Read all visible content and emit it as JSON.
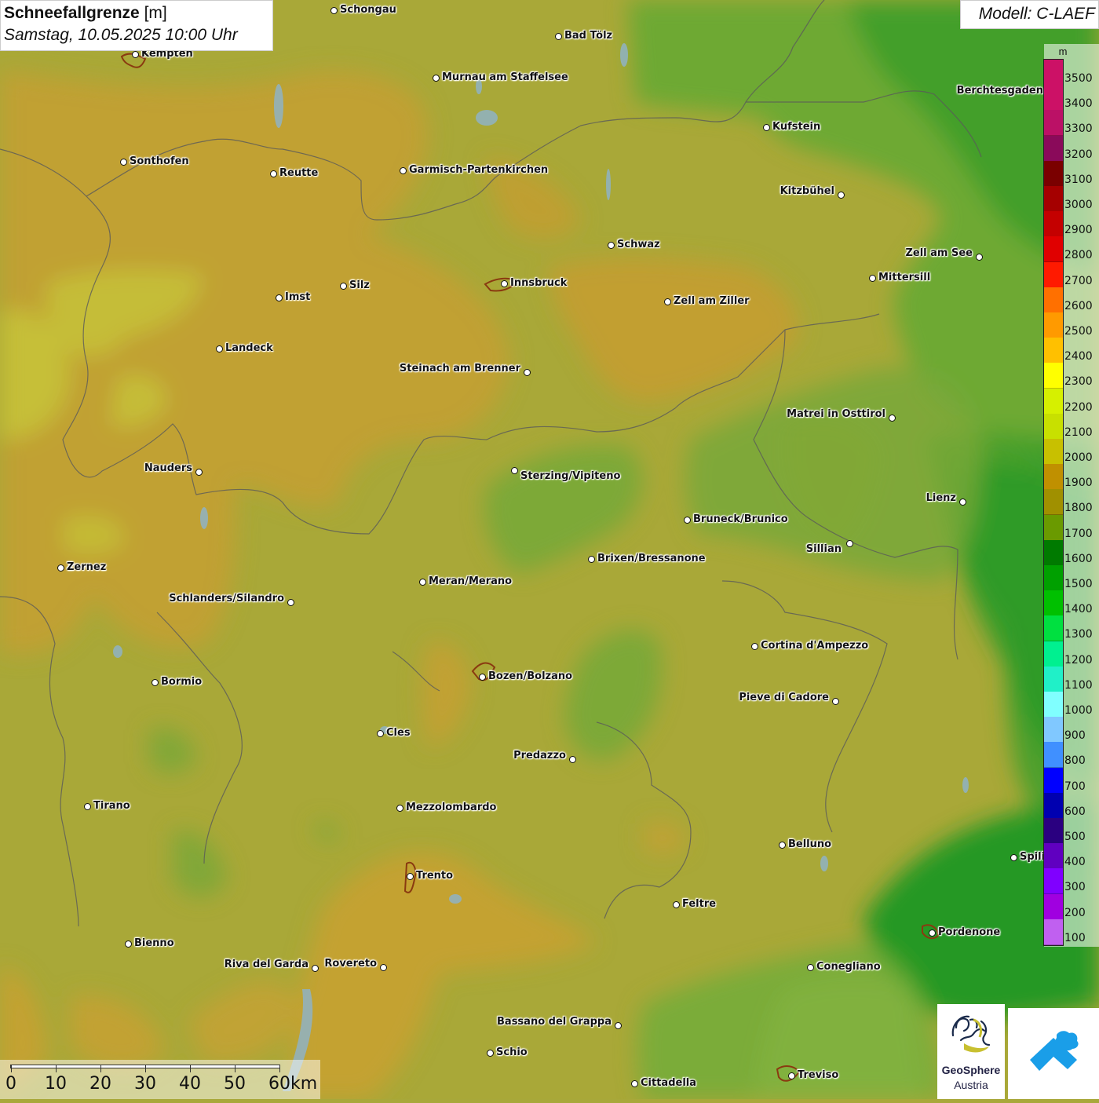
{
  "header": {
    "title": "Schneefallgrenze",
    "unit": "[m]",
    "datetime": "Samstag, 10.05.2025 10:00 Uhr",
    "model": "Modell: C-LAEF"
  },
  "legend": {
    "unit": "m",
    "classes": [
      {
        "label": "3500",
        "color": "#cc1166"
      },
      {
        "label": "3400",
        "color": "#cc1166"
      },
      {
        "label": "3300",
        "color": "#bb1166"
      },
      {
        "label": "3200",
        "color": "#8a0a5a"
      },
      {
        "label": "3100",
        "color": "#7a0000"
      },
      {
        "label": "3000",
        "color": "#a50000"
      },
      {
        "label": "2900",
        "color": "#c40000"
      },
      {
        "label": "2800",
        "color": "#e00000"
      },
      {
        "label": "2700",
        "color": "#ff1a00"
      },
      {
        "label": "2600",
        "color": "#ff7000"
      },
      {
        "label": "2500",
        "color": "#ff9a00"
      },
      {
        "label": "2400",
        "color": "#ffc000"
      },
      {
        "label": "2300",
        "color": "#ffff00"
      },
      {
        "label": "2200",
        "color": "#d6f000"
      },
      {
        "label": "2100",
        "color": "#c8e000"
      },
      {
        "label": "2000",
        "color": "#c8c000"
      },
      {
        "label": "1900",
        "color": "#c09000"
      },
      {
        "label": "1800",
        "color": "#a09000"
      },
      {
        "label": "1700",
        "color": "#6a9a00"
      },
      {
        "label": "1600",
        "color": "#007a00"
      },
      {
        "label": "1500",
        "color": "#00a000"
      },
      {
        "label": "1400",
        "color": "#00c000"
      },
      {
        "label": "1300",
        "color": "#00e040"
      },
      {
        "label": "1200",
        "color": "#00f090"
      },
      {
        "label": "1100",
        "color": "#20f0c8"
      },
      {
        "label": "1000",
        "color": "#80ffff"
      },
      {
        "label": "900",
        "color": "#80c8ff"
      },
      {
        "label": "800",
        "color": "#4090ff"
      },
      {
        "label": "700",
        "color": "#0000ff"
      },
      {
        "label": "600",
        "color": "#0000b0"
      },
      {
        "label": "500",
        "color": "#2a0080"
      },
      {
        "label": "400",
        "color": "#6000c0"
      },
      {
        "label": "300",
        "color": "#8000ff"
      },
      {
        "label": "200",
        "color": "#a000e0"
      },
      {
        "label": "100",
        "color": "#c060f0"
      }
    ]
  },
  "scale": {
    "labels": [
      "0",
      "10",
      "20",
      "30",
      "40",
      "50",
      "60km"
    ]
  },
  "cities": [
    {
      "name": "Schongau"
    },
    {
      "name": "Bad Tölz"
    },
    {
      "name": "Kempten"
    },
    {
      "name": "Murnau am Staffelsee"
    },
    {
      "name": "Berchtesgaden"
    },
    {
      "name": "Kufstein"
    },
    {
      "name": "Sonthofen"
    },
    {
      "name": "Reutte"
    },
    {
      "name": "Garmisch-Partenkirchen"
    },
    {
      "name": "Kitzbühel"
    },
    {
      "name": "Schwaz"
    },
    {
      "name": "Zell am See"
    },
    {
      "name": "Mittersill"
    },
    {
      "name": "Innsbruck"
    },
    {
      "name": "Silz"
    },
    {
      "name": "Imst"
    },
    {
      "name": "Zell am Ziller"
    },
    {
      "name": "Landeck"
    },
    {
      "name": "Steinach am Brenner"
    },
    {
      "name": "Matrei in Osttirol"
    },
    {
      "name": "Nauders"
    },
    {
      "name": "Sterzing/Vipiteno"
    },
    {
      "name": "Lienz"
    },
    {
      "name": "Bruneck/Brunico"
    },
    {
      "name": "Sillian"
    },
    {
      "name": "Zernez"
    },
    {
      "name": "Brixen/Bressanone"
    },
    {
      "name": "Meran/Merano"
    },
    {
      "name": "Schlanders/Silandro"
    },
    {
      "name": "Cortina d'Ampezzo"
    },
    {
      "name": "Bormio"
    },
    {
      "name": "Bozen/Bolzano"
    },
    {
      "name": "Pieve di Cadore"
    },
    {
      "name": "Cles"
    },
    {
      "name": "Predazzo"
    },
    {
      "name": "Tirano"
    },
    {
      "name": "Mezzolombardo"
    },
    {
      "name": "Belluno"
    },
    {
      "name": "Spili"
    },
    {
      "name": "Trento"
    },
    {
      "name": "Feltre"
    },
    {
      "name": "Bienno"
    },
    {
      "name": "Pordenone"
    },
    {
      "name": "Riva del Garda"
    },
    {
      "name": "Rovereto"
    },
    {
      "name": "Conegliano"
    },
    {
      "name": "Bassano del Grappa"
    },
    {
      "name": "Schio"
    },
    {
      "name": "Treviso"
    },
    {
      "name": "Cittadella"
    }
  ],
  "logo": {
    "name": "GeoSphere",
    "sub": "Austria"
  }
}
